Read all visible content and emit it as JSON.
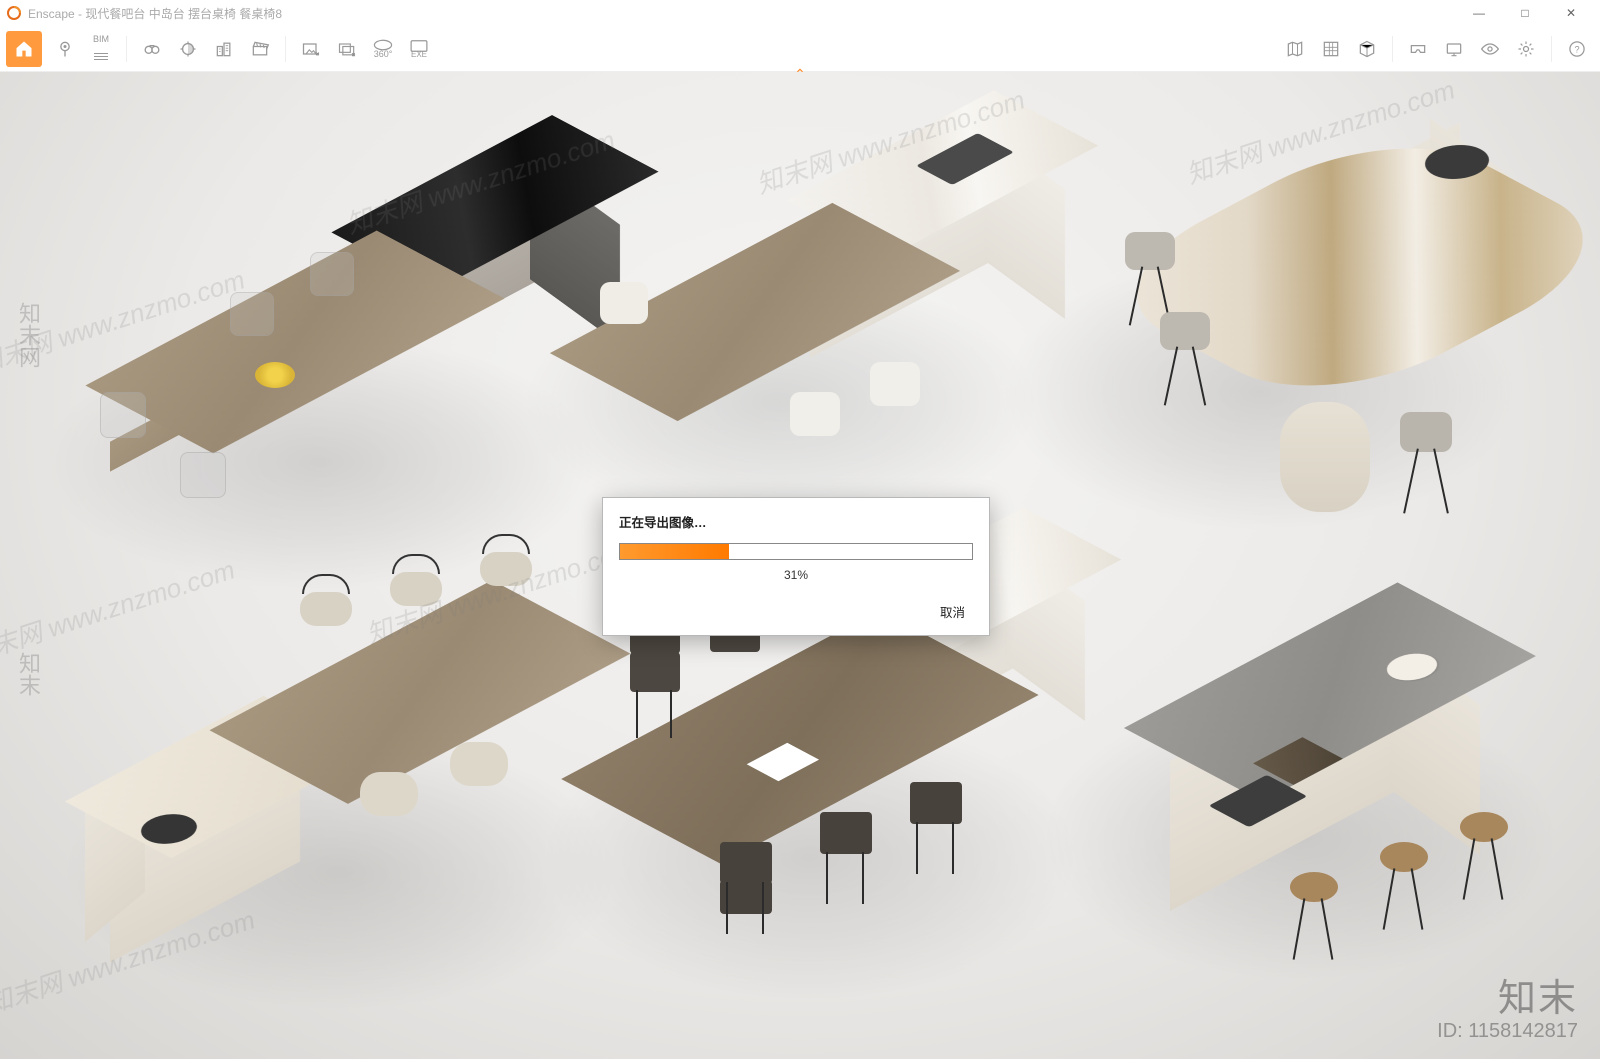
{
  "app": {
    "name": "Enscape",
    "title_suffix": "现代餐吧台 中岛台 摆台桌椅 餐桌椅8"
  },
  "window_controls": {
    "minimize": "—",
    "maximize": "□",
    "close": "✕"
  },
  "toolbar": {
    "left": [
      {
        "name": "home-icon",
        "glyph": "⌂"
      },
      {
        "name": "pin-icon",
        "glyph": "📍"
      },
      {
        "name": "bim-menu-icon",
        "label": "BIM"
      },
      {
        "name": "binoculars-icon",
        "glyph": "🔭"
      },
      {
        "name": "sun-orbit-icon",
        "glyph": "◐"
      },
      {
        "name": "buildings-icon",
        "glyph": "🏙"
      },
      {
        "name": "clapper-icon",
        "glyph": "🎬"
      },
      {
        "name": "screenshot-icon",
        "glyph": "⧉"
      },
      {
        "name": "batch-screenshot-icon",
        "glyph": "⧉"
      },
      {
        "name": "panorama-360-icon",
        "glyph": "360°"
      },
      {
        "name": "export-exe-icon",
        "glyph": "EXE"
      }
    ],
    "right": [
      {
        "name": "map-icon",
        "glyph": "🗺"
      },
      {
        "name": "asset-library-icon",
        "glyph": "▦"
      },
      {
        "name": "3d-box-icon",
        "glyph": "❒"
      },
      {
        "name": "vr-headset-icon",
        "glyph": "ᚸ"
      },
      {
        "name": "presentation-icon",
        "glyph": "▭"
      },
      {
        "name": "visual-settings-icon",
        "glyph": "👁"
      },
      {
        "name": "settings-gear-icon",
        "glyph": "⚙"
      },
      {
        "name": "help-icon",
        "glyph": "?"
      }
    ]
  },
  "dialog": {
    "title": "正在导出图像…",
    "percent": 31,
    "percent_label": "31%",
    "cancel": "取消"
  },
  "watermark": {
    "repeat_text": "知末网 www.znzmo.com",
    "brand": "知末",
    "id_label": "ID: 1158142817"
  }
}
